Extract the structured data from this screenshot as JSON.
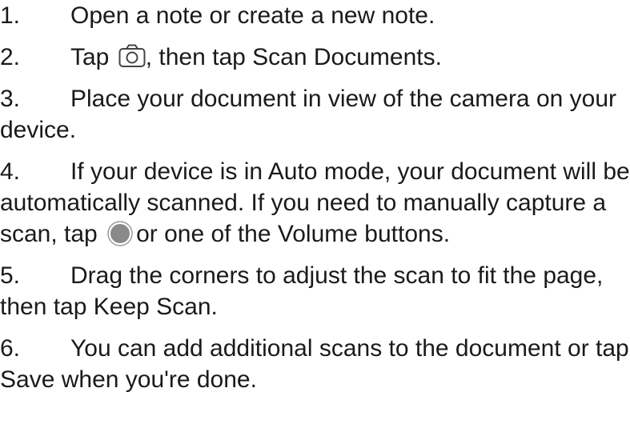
{
  "steps": [
    {
      "number": "1.",
      "text": "Open a note or create a new note."
    },
    {
      "number": "2.",
      "text_before_icon": "Tap",
      "icon": "camera-icon",
      "text_after_icon": ", then tap Scan Documents."
    },
    {
      "number": "3.",
      "text": "Place your document in view of the camera on your device."
    },
    {
      "number": "4.",
      "text_before_icon": "If your device is in Auto mode, your document will be automatically scanned. If you need to manually capture a scan, tap",
      "icon": "shutter-button-icon",
      "text_after_icon": "or one of the Volume buttons."
    },
    {
      "number": "5.",
      "text": "Drag the corners to adjust the scan to fit the page, then tap Keep Scan."
    },
    {
      "number": "6.",
      "text": "You can add additional scans to the document or tap Save when you're done."
    }
  ],
  "colors": {
    "text": "#1a1a1a",
    "icon_stroke": "#444444",
    "shutter_fill": "#8a8a8a"
  }
}
